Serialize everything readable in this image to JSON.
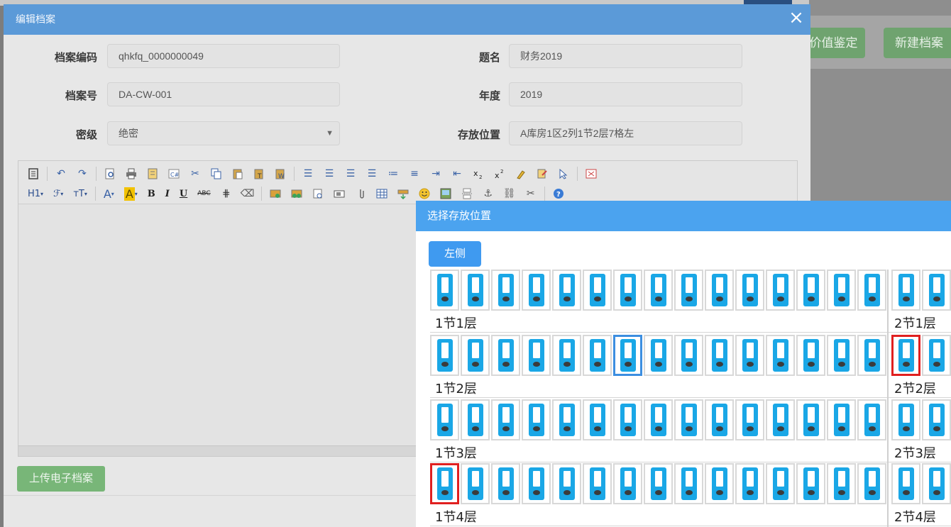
{
  "background": {
    "value_button_label": "价值鉴定",
    "new_button_label": "新建档案"
  },
  "dialog": {
    "title": "编辑档案",
    "close_symbol": "×",
    "fields": {
      "code": {
        "label": "档案编码",
        "value": "qhkfq_0000000049"
      },
      "title": {
        "label": "题名",
        "value": "财务2019"
      },
      "number": {
        "label": "档案号",
        "value": "DA-CW-001"
      },
      "year": {
        "label": "年度",
        "value": "2019"
      },
      "secrecy": {
        "label": "密级",
        "value": "绝密"
      },
      "location": {
        "label": "存放位置",
        "value": "A库房1区2列1节2层7格左"
      }
    },
    "toolbar": {
      "heading_label": "H1",
      "font_label": "ℱ",
      "size_label": "тT",
      "font_color_label": "A",
      "bg_color_label": "A",
      "bold_label": "B",
      "italic_label": "I",
      "underline_label": "U",
      "strike_label": "ABC"
    },
    "upload_button_label": "上传电子档案"
  },
  "picker": {
    "title": "选择存放位置",
    "side_button_label": "左侧",
    "rows": [
      {
        "section1_label": "1节1层",
        "section2_label": "2节1层",
        "blue": -1,
        "red1": -1,
        "red2": -1
      },
      {
        "section1_label": "1节2层",
        "section2_label": "2节2层",
        "blue": 6,
        "red1": -1,
        "red2": 0
      },
      {
        "section1_label": "1节3层",
        "section2_label": "2节3层",
        "blue": -1,
        "red1": -1,
        "red2": -1
      },
      {
        "section1_label": "1节4层",
        "section2_label": "2节4层",
        "blue": -1,
        "red1": 0,
        "red2": -1
      }
    ]
  },
  "colors": {
    "dialog_header": "#5b9ad8",
    "picker_header": "#4ba3ef",
    "binder": "#1aa7e6",
    "selected_blue": "#3c8ee0",
    "selected_red": "#e02020",
    "upload_green": "#78b678"
  }
}
